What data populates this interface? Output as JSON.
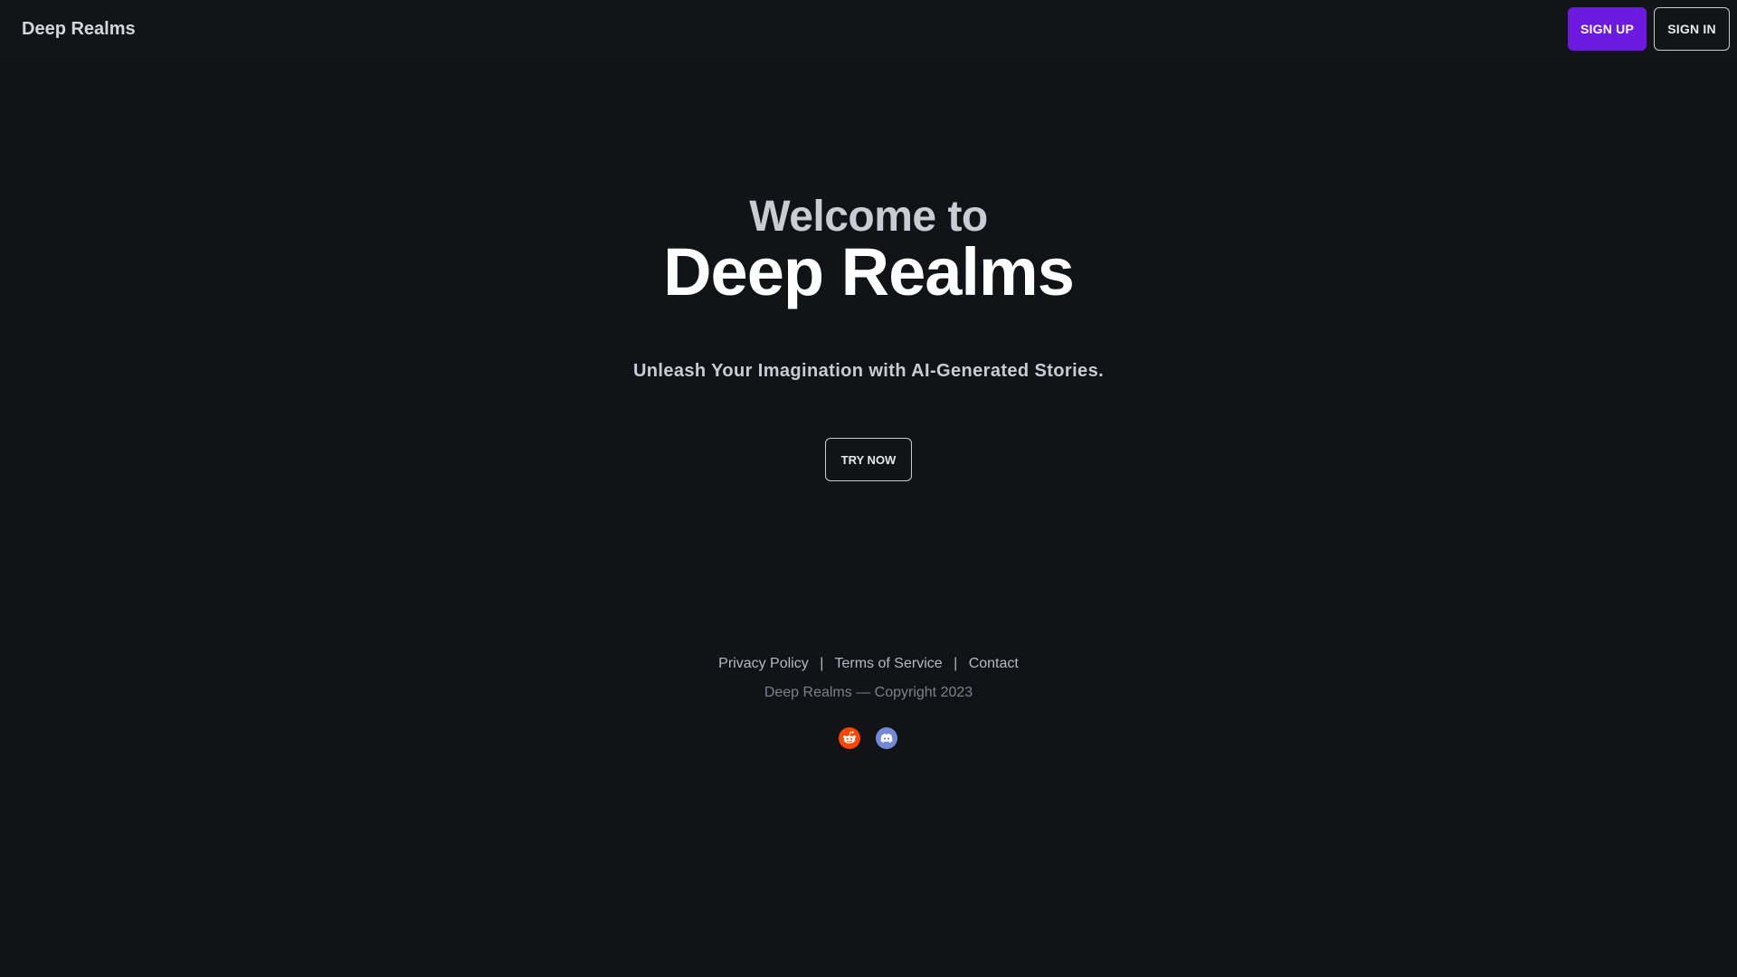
{
  "header": {
    "brand": "Deep Realms",
    "signup_label": "SIGN UP",
    "signin_label": "SIGN IN"
  },
  "hero": {
    "welcome": "Welcome to",
    "title": "Deep Realms",
    "tagline": "Unleash Your Imagination with AI-Generated Stories.",
    "cta_label": "TRY NOW"
  },
  "footer": {
    "links": [
      "Privacy Policy",
      "Terms of Service",
      "Contact"
    ],
    "separator": "|",
    "copyright": "Deep Realms — Copyright 2023",
    "socials": [
      {
        "icon": "reddit-icon",
        "color": "#ff4500"
      },
      {
        "icon": "discord-icon",
        "color": "#7289da"
      }
    ]
  },
  "colors": {
    "background": "#121317",
    "accent": "#6d1ae0"
  }
}
